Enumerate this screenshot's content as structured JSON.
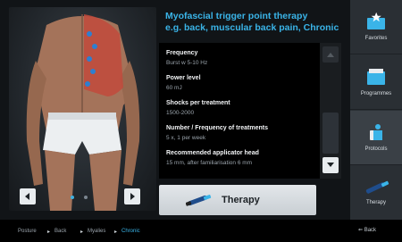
{
  "title": "Myofascial trigger point therapy\ne.g. back, muscular back pain, Chronic",
  "info": [
    {
      "label": "Frequency",
      "value": "Burst w 5-10 Hz"
    },
    {
      "label": "Power level",
      "value": "60 mJ"
    },
    {
      "label": "Shocks per treatment",
      "value": "1500-2000"
    },
    {
      "label": "Number / Frequency of treatments",
      "value": "5 x, 1 per week"
    },
    {
      "label": "Recommended applicator head",
      "value": "15 mm, after familiarisation 6 mm"
    }
  ],
  "therapy_button": {
    "label": "Therapy"
  },
  "sidebar": {
    "items": [
      {
        "label": "Favorites",
        "icon": "favorites-icon"
      },
      {
        "label": "Programmes",
        "icon": "programmes-icon"
      },
      {
        "label": "Protocols",
        "icon": "protocols-icon"
      },
      {
        "label": "Therapy",
        "icon": "therapy-icon"
      }
    ]
  },
  "breadcrumb": [
    "Posture",
    "Back",
    "Myalies",
    "Chronic"
  ],
  "back": {
    "label": "Back"
  },
  "carousel": {
    "pages": 2,
    "current": 1
  },
  "colors": {
    "accent": "#3ab4e8",
    "background": "#111417",
    "sidebar": "#2a2f34"
  }
}
